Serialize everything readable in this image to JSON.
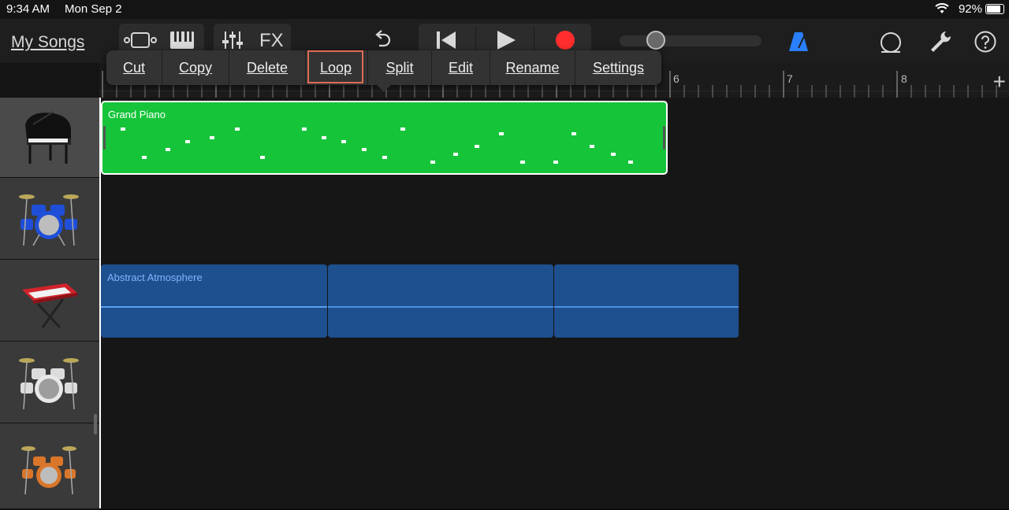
{
  "status": {
    "time": "9:34 AM",
    "date": "Mon Sep 2",
    "battery": "92%"
  },
  "toolbar": {
    "my_songs": "My Songs",
    "fx": "FX",
    "icons": [
      "tracks-view-icon",
      "keyboard-icon",
      "mixer-icon",
      "undo-icon",
      "rewind-icon",
      "play-icon",
      "record-icon",
      "metronome-icon",
      "loop-browser-icon",
      "wrench-icon",
      "help-icon"
    ],
    "record_color": "#ff2d2d",
    "accent": "#2a7fff"
  },
  "volume": {
    "level": 0.2
  },
  "ruler": {
    "bars": [
      "6",
      "7",
      "8"
    ]
  },
  "context_menu": {
    "items": [
      "Cut",
      "Copy",
      "Delete",
      "Loop",
      "Split",
      "Edit",
      "Rename",
      "Settings"
    ],
    "highlighted": "Loop"
  },
  "tracks": [
    {
      "instrument": "grand-piano",
      "selected": true
    },
    {
      "instrument": "blue-drum-kit"
    },
    {
      "instrument": "red-keyboard"
    },
    {
      "instrument": "silver-drum-kit"
    },
    {
      "instrument": "orange-drum-kit"
    }
  ],
  "regions": {
    "piano": {
      "name": "Grand Piano",
      "color": "#16c43a"
    },
    "atmos": {
      "name": "Abstract Atmosphere",
      "color": "#1e4f8e"
    }
  }
}
